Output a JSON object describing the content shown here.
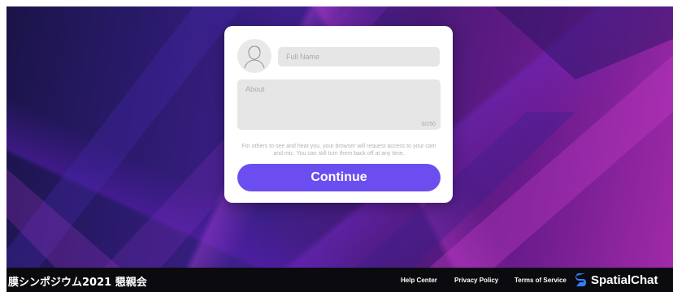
{
  "form": {
    "avatar_icon": "user-avatar-icon",
    "full_name_placeholder": "Full Name",
    "full_name_value": "",
    "about_placeholder": "About",
    "about_value": "",
    "about_counter": "0/250",
    "notice": "For others to see and hear you, your browser will request access to your cam and mic. You can still turn them back off at any time.",
    "continue_label": "Continue"
  },
  "footer": {
    "event_title": "膜シンポジウム2021 懇親会",
    "links": [
      "Help Center",
      "Privacy Policy",
      "Terms of Service"
    ],
    "brand_name": "SpatialChat",
    "brand_icon": "spatialchat-logo-icon"
  },
  "colors": {
    "accent": "#6c4ef0",
    "brand_logo": "#2f80ff",
    "footer_bg": "#0b0b0f"
  }
}
